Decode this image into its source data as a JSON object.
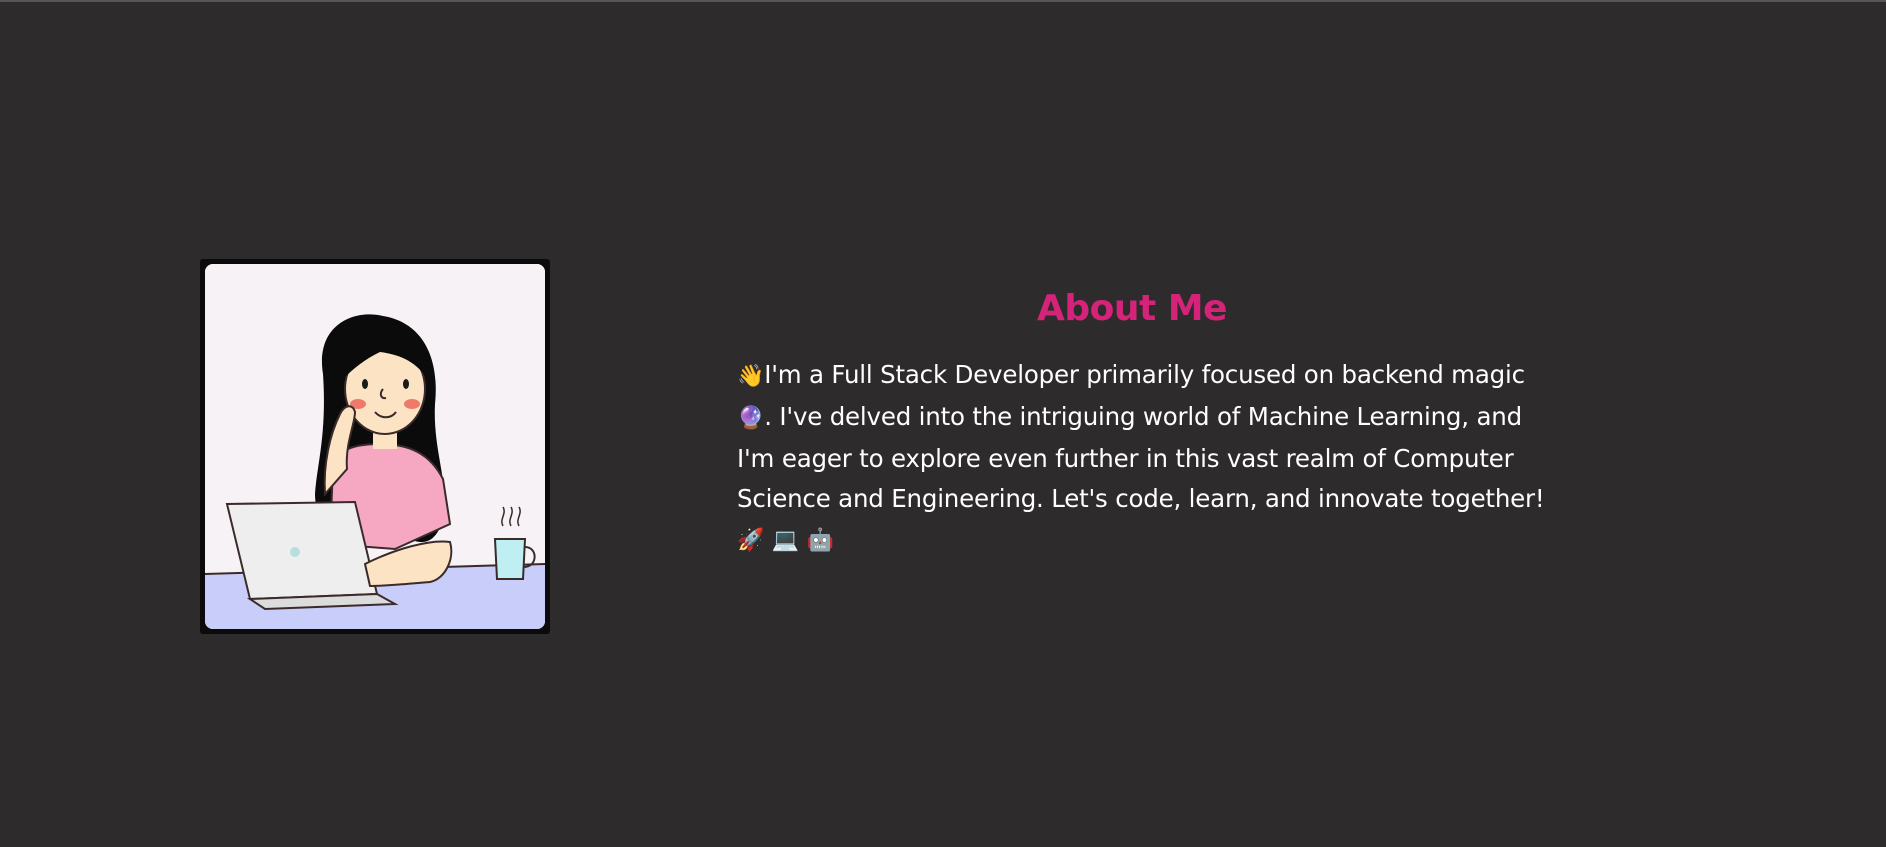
{
  "about": {
    "title": "About Me",
    "emoji_wave": "👋",
    "text_part1": "I'm a Full Stack Developer primarily focused on backend magic ",
    "emoji_crystal": "🔮",
    "text_part2": ". I've delved into the intriguing world of Machine Learning, and I'm eager to explore even further in this vast realm of Computer Science and Engineering. Let's code, learn, and innovate together! ",
    "emoji_rocket": "🚀",
    "emoji_laptop": "💻",
    "emoji_robot": "🤖"
  },
  "avatar": {
    "icon": "girl-with-laptop-illustration"
  },
  "colors": {
    "background": "#2d2b2c",
    "accent": "#d6237a",
    "text": "#ffffff"
  }
}
